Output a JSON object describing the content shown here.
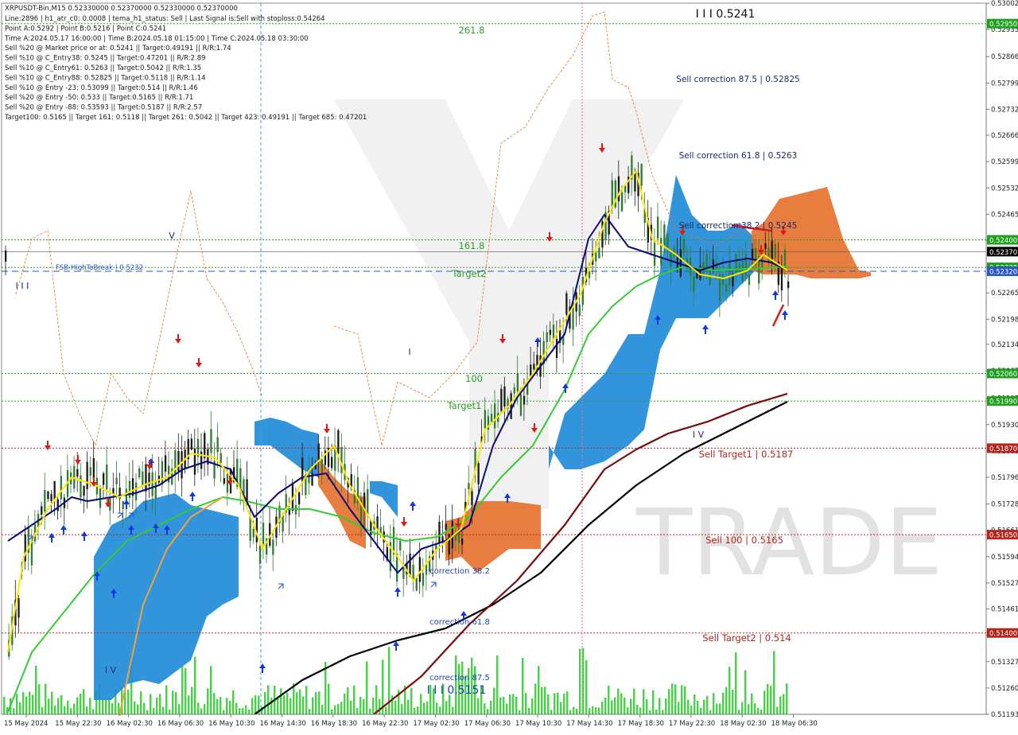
{
  "chart_data": {
    "type": "candlestick",
    "symbol_line": "XRPUSDT-Bin,M15  0.52330000 0.52370000 0.52330000 0.52370000",
    "info_lines": [
      "Line:2896 | h1_atr_c0: 0.0008 | tema_h1_status: Sell | Last Signal is:Sell with stoploss:0.54264",
      "Point A:0.5292 | Point B:0.5216 | Point C:0.5241",
      "Time A:2024.05.17 16:00:00 | Time B:2024.05.18 01:15:00 | Time C:2024.05.18 03:30:00",
      "Sell %20 @ Market price or at: 0.5241 || Target:0.49191 || R/R:1.74",
      "Sell %10 @ C_Entry38: 0.5245 || Target:0.47201 || R/R:2.89",
      "Sell %10 @ C_Entry61: 0.5263 || Target:0.5042 || R/R:1.35",
      "Sell %10 @ C_Entry88: 0.52825 || Target:0.5118 || R/R:1.14",
      "Sell %10 @ Entry -23: 0.53099 || Target:0.514 || R/R:1.46",
      "Sell %20 @ Entry -50: 0.533 || Target:0.5165 || R/R:1.71",
      "Sell %20 @ Entry -88: 0.53593 || Target:0.5187 || R/R:2.57",
      "Target100: 0.5165 || Target 161: 0.5118 || Target 261: 0.5042 || Target 423: 0.49191 || Target 685: 0.47201"
    ],
    "y_range": [
      0.51193,
      0.53002
    ],
    "y_ticks": [
      "0.53002",
      "0.52935",
      "0.52866",
      "0.52799",
      "0.52732",
      "0.52666",
      "0.52599",
      "0.52532",
      "0.52465",
      "0.52398",
      "0.52332",
      "0.52265",
      "0.52198",
      "0.52134",
      "0.52067",
      "0.51997",
      "0.51930",
      "0.51863",
      "0.51796",
      "0.51728",
      "0.51661",
      "0.51594",
      "0.51527",
      "0.51461",
      "0.51394",
      "0.51327",
      "0.51260",
      "0.51193"
    ],
    "x_labels": [
      "15 May 2024",
      "15 May 22:30",
      "16 May 02:30",
      "16 May 06:30",
      "16 May 10:30",
      "16 May 14:30",
      "16 May 18:30",
      "16 May 22:30",
      "17 May 02:30",
      "17 May 06:30",
      "17 May 10:30",
      "17 May 14:30",
      "17 May 18:30",
      "17 May 22:30",
      "18 May 02:30",
      "18 May 06:30"
    ],
    "price_tags": [
      {
        "label": "0.52950",
        "value": 0.5295,
        "color": "#1fa01f"
      },
      {
        "label": "0.52400",
        "value": 0.524,
        "color": "#1fa01f"
      },
      {
        "label": "0.52370",
        "value": 0.5237,
        "color": "#000000"
      },
      {
        "label": "0.52330",
        "value": 0.5233,
        "color": "#1fa01f"
      },
      {
        "label": "0.52320",
        "value": 0.5232,
        "color": "#2a56c6"
      },
      {
        "label": "0.52060",
        "value": 0.5206,
        "color": "#1fa01f"
      },
      {
        "label": "0.51990",
        "value": 0.5199,
        "color": "#1fa01f"
      },
      {
        "label": "0.51870",
        "value": 0.5187,
        "color": "#b3261e"
      },
      {
        "label": "0.51650",
        "value": 0.5165,
        "color": "#b3261e"
      },
      {
        "label": "0.51400",
        "value": 0.514,
        "color": "#b3261e"
      }
    ],
    "levels": [
      {
        "label": "261.8",
        "value": 0.5295,
        "color": "#2a9d2a",
        "style": "dotted"
      },
      {
        "label": "161.8",
        "value": 0.524,
        "color": "#2a9d2a",
        "style": "dotted"
      },
      {
        "label": "Target2",
        "value": 0.5233,
        "color": "#2a9d2a",
        "style": "dotted"
      },
      {
        "label": "100",
        "value": 0.5206,
        "color": "#2a9d2a",
        "style": "dotted"
      },
      {
        "label": "Target1",
        "value": 0.5199,
        "color": "#2a9d2a",
        "style": "dotted"
      },
      {
        "label": "Sell Target1 | 0.5187",
        "value": 0.5187,
        "color": "#b3261e",
        "style": "dotted"
      },
      {
        "label": "Sell 100 | 0.5165",
        "value": 0.5165,
        "color": "#b3261e",
        "style": "dotted"
      },
      {
        "label": "Sell Target2 | 0.514",
        "value": 0.514,
        "color": "#b3261e",
        "style": "dotted"
      },
      {
        "label": "FSB-HighToBreak | 0.5232",
        "value": 0.5232,
        "color": "#2a56c6",
        "style": "dashed"
      }
    ],
    "annotations": [
      {
        "text": "I I I 0.5241",
        "color": "#111111"
      },
      {
        "text": "Sell correction 87.5 | 0.52825",
        "color": "#1a2a6c"
      },
      {
        "text": "Sell correction 61.8 | 0.5263",
        "color": "#1a2a6c"
      },
      {
        "text": "Sell correction 38.2 | 0.5245",
        "color": "#1a2a6c"
      },
      {
        "text": "correction 38.2",
        "color": "#1f3fb8"
      },
      {
        "text": "correction 61.8",
        "color": "#1f3fb8"
      },
      {
        "text": "correction 87.5",
        "color": "#1f3fb8"
      },
      {
        "text": "I I I 0.5151",
        "color": "#1f3fb8"
      },
      {
        "text": "I V",
        "color": "#1a2a6c"
      },
      {
        "text": "I V",
        "color": "#1a2a6c"
      },
      {
        "text": "V",
        "color": "#1a2a6c"
      },
      {
        "text": "I I I",
        "color": "#1a2a6c"
      },
      {
        "text": "I",
        "color": "#1a2a6c"
      }
    ],
    "watermark": "TRADE",
    "colors": {
      "bull_candle": "#2e7d32",
      "bear_candle": "#1b1b1b",
      "ma_yellow": "#ffe600",
      "ma_green": "#33cc33",
      "ma_navy": "#0b0b7a",
      "ma_dark_red": "#7a0a0a",
      "ma_black": "#000000",
      "cloud_blue": "#1c8ad8",
      "cloud_orange": "#e4702a",
      "volume": "#33cc33"
    }
  }
}
